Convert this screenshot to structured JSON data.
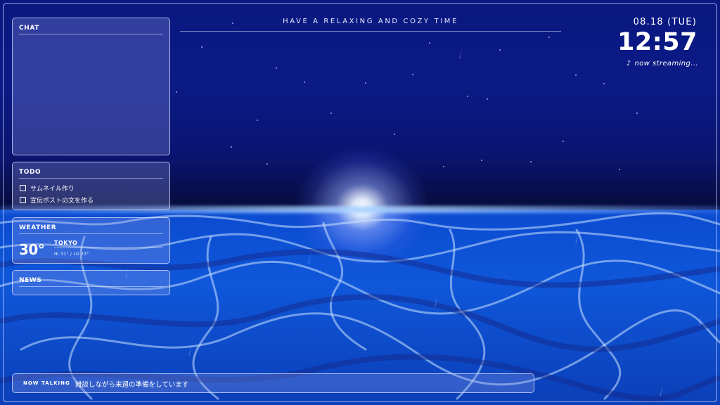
{
  "header": {
    "tagline": "HAVE A RELAXING AND COZY TIME"
  },
  "clock": {
    "date": "08.18 (TUE)",
    "time": "12:57",
    "streaming_icon": "music-note-icon",
    "streaming_glyph": "♪",
    "streaming_text": "now streaming..."
  },
  "chat": {
    "title": "CHAT"
  },
  "todo": {
    "title": "TODO",
    "items": [
      {
        "label": "サムネイル作り",
        "checked": false
      },
      {
        "label": "宣伝ポストの文を作る",
        "checked": false
      }
    ]
  },
  "weather": {
    "title": "WEATHER",
    "temperature": "30°",
    "city": "TOKYO",
    "hilo": "HI 31°  / LO 23°"
  },
  "news": {
    "title": "NEWS"
  },
  "now_talking": {
    "label": "NOW TALKING",
    "text": "雑談しながら来週の準備をしています"
  },
  "colors": {
    "sky_top": "#0a1780",
    "sky_horizon": "#060c3a",
    "water": "#0f57da",
    "panel_border": "#dce1ff",
    "text": "#ffffff"
  }
}
